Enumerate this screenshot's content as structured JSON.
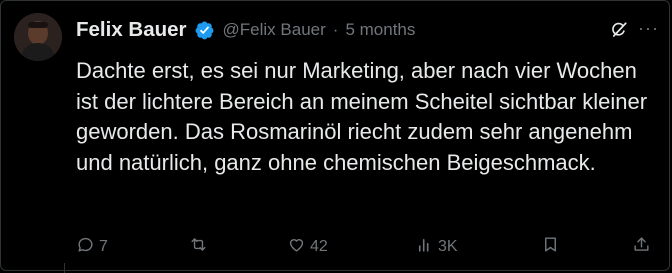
{
  "post": {
    "author_name": "Felix Bauer",
    "handle": "@Felix Bauer",
    "separator": "·",
    "time": "5 months",
    "more_label": "···",
    "text": "Dachte erst, es sei nur Marketing, aber nach vier Wochen ist der lichtere Bereich an meinem Scheitel sichtbar kleiner geworden. Das Rosmarinöl riecht zudem sehr angenehm und natürlich, ganz ohne chemischen Beigeschmack."
  },
  "actions": {
    "reply_count": "7",
    "repost_count": "",
    "like_count": "42",
    "views_count": "3K"
  },
  "colors": {
    "background": "#000000",
    "text": "#e7e9ea",
    "muted": "#71767b",
    "verified": "#1d9bf0"
  },
  "icons": [
    "verified-badge-icon",
    "grok-icon",
    "more-icon",
    "reply-icon",
    "repost-icon",
    "like-icon",
    "views-icon",
    "bookmark-icon",
    "share-icon"
  ]
}
